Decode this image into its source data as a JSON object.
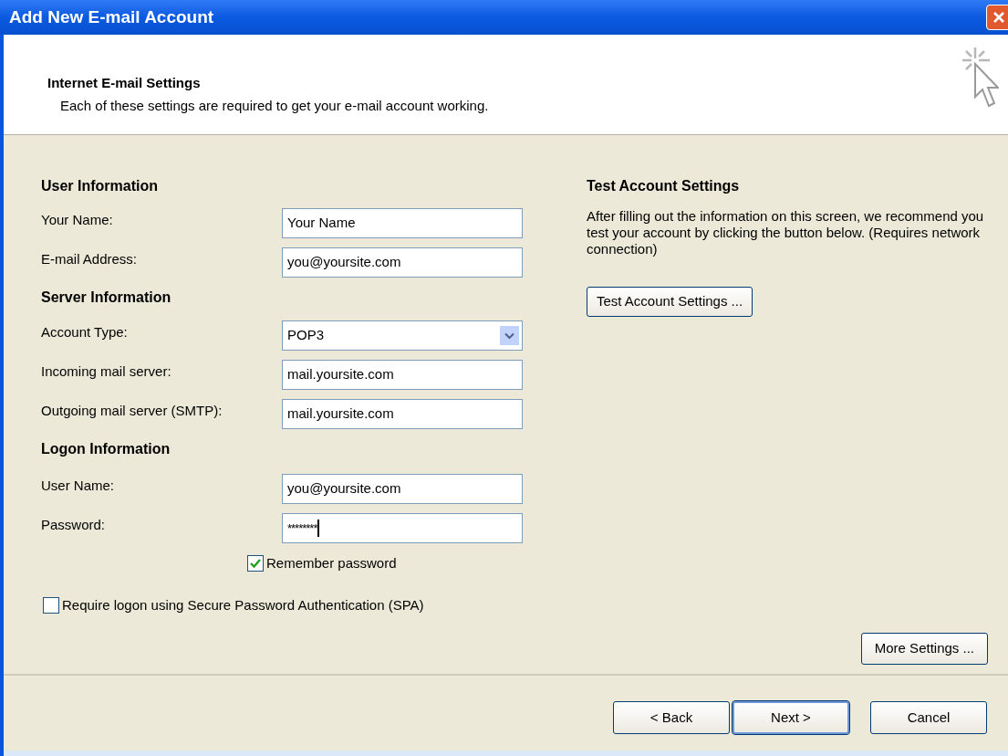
{
  "window": {
    "title": "Add New E-mail Account"
  },
  "header": {
    "title": "Internet E-mail Settings",
    "subtitle": "Each of these settings are required to get your e-mail account working."
  },
  "sections": [
    {
      "heading": "User Information",
      "fields": [
        {
          "label": "Your Name:",
          "value": "Your Name",
          "kind": "text"
        },
        {
          "label": "E-mail Address:",
          "value": "you@yoursite.com",
          "kind": "text"
        }
      ]
    },
    {
      "heading": "Server Information",
      "fields": [
        {
          "label": "Account Type:",
          "value": "POP3",
          "kind": "select"
        },
        {
          "label": "Incoming mail server:",
          "value": "mail.yoursite.com",
          "kind": "text"
        },
        {
          "label": "Outgoing mail server (SMTP):",
          "value": "mail.yoursite.com",
          "kind": "text"
        }
      ]
    },
    {
      "heading": "Logon Information",
      "fields": [
        {
          "label": "User Name:",
          "value": "you@yoursite.com",
          "kind": "text"
        },
        {
          "label": "Password:",
          "value": "********",
          "kind": "password"
        }
      ]
    }
  ],
  "remember_password": {
    "label": "Remember password",
    "checked": true
  },
  "spa": {
    "label": "Require logon using Secure Password Authentication (SPA)",
    "checked": false
  },
  "test": {
    "heading": "Test Account Settings",
    "description": "After filling out the information on this screen, we recommend you test your account by clicking the button below. (Requires network connection)",
    "button": "Test Account Settings ..."
  },
  "more_settings": "More Settings ...",
  "buttons": [
    {
      "label": "< Back",
      "default": false
    },
    {
      "label": "Next >",
      "default": true
    },
    {
      "label": "Cancel",
      "default": false
    }
  ]
}
